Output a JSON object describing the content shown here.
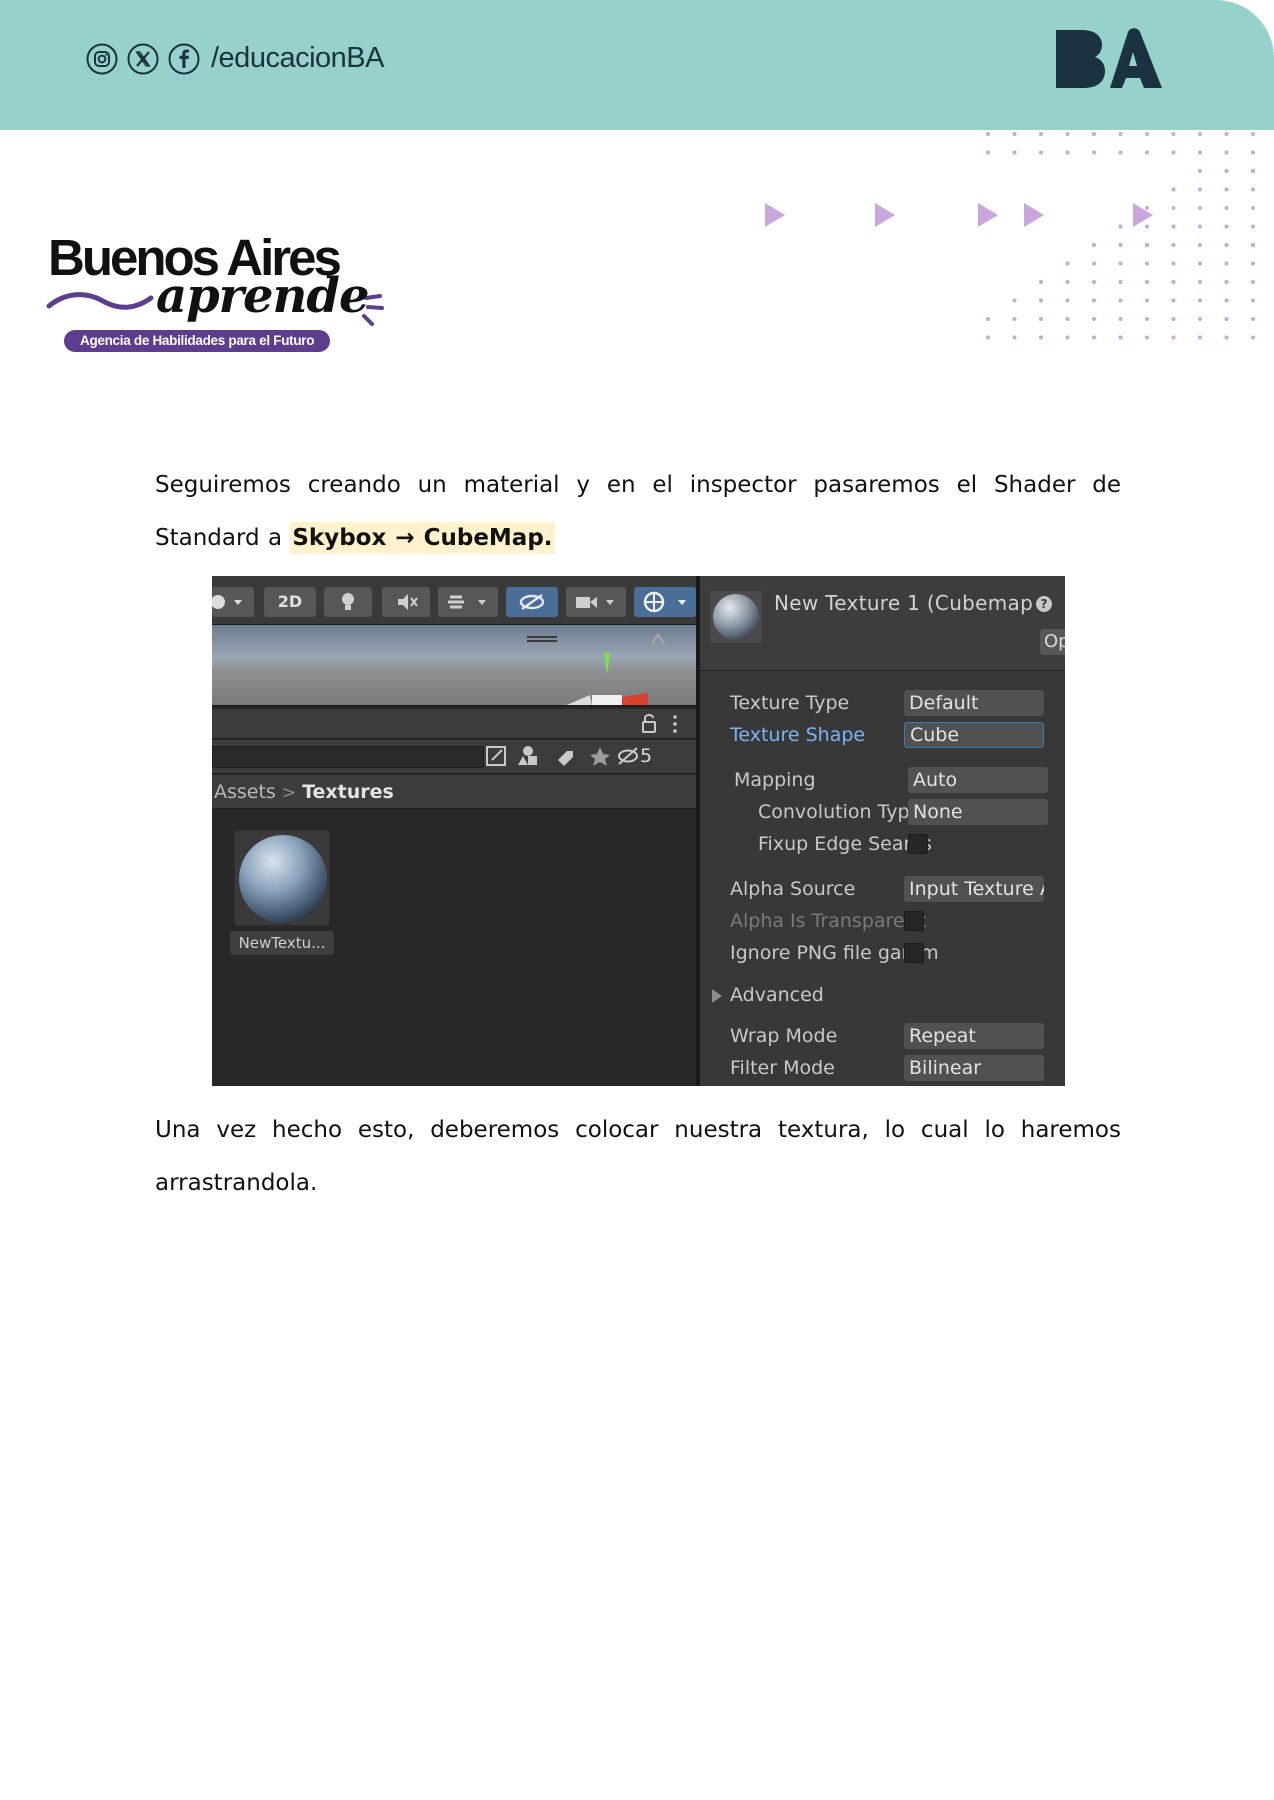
{
  "header": {
    "social_handle": "/educacionBA",
    "social_icons": [
      "instagram-icon",
      "x-icon",
      "facebook-icon"
    ],
    "logo_text": "BA",
    "band_color": "#96d2cb",
    "logo_color": "#1b3340"
  },
  "brand": {
    "line1": "Buenos Aires",
    "line2": "aprende",
    "tagline": "Agencia de Habilidades para el Futuro",
    "accent_color": "#5f3d8e"
  },
  "decor": {
    "arrow_color": "#c9a6dc",
    "dot_color": "#c9a6dc"
  },
  "body": {
    "para1_text": "Seguiremos creando un material y en el inspector pasaremos  el Shader de Standard a ",
    "para1_highlight": "Skybox → CubeMap.",
    "para2_text": "Una vez hecho esto, deberemos colocar nuestra textura, lo cual lo haremos arrastrandola."
  },
  "screenshot": {
    "toolbar_2d_label": "2D",
    "hidden_count": "5",
    "breadcrumb_root": "Assets",
    "breadcrumb_sep": ">",
    "breadcrumb_current": "Textures",
    "asset_name": "NewTextu...",
    "inspector_title": "New Texture 1 (Cubemap",
    "help_glyph": "?",
    "open_button_label": "Op",
    "properties": {
      "texture_type_label": "Texture Type",
      "texture_type_value": "Default",
      "texture_shape_label": "Texture Shape",
      "texture_shape_value": "Cube",
      "mapping_label": "Mapping",
      "mapping_value": "Auto",
      "convolution_label": "Convolution Type",
      "convolution_value": "None",
      "fixup_label": "Fixup Edge Seams",
      "alpha_source_label": "Alpha Source",
      "alpha_source_value": "Input Texture A",
      "alpha_transparency_label": "Alpha Is Transparenc",
      "ignore_png_label": "Ignore PNG file gamm",
      "advanced_label": "Advanced",
      "wrap_mode_label": "Wrap Mode",
      "wrap_mode_value": "Repeat",
      "filter_mode_label": "Filter Mode",
      "filter_mode_value": "Bilinear"
    }
  }
}
